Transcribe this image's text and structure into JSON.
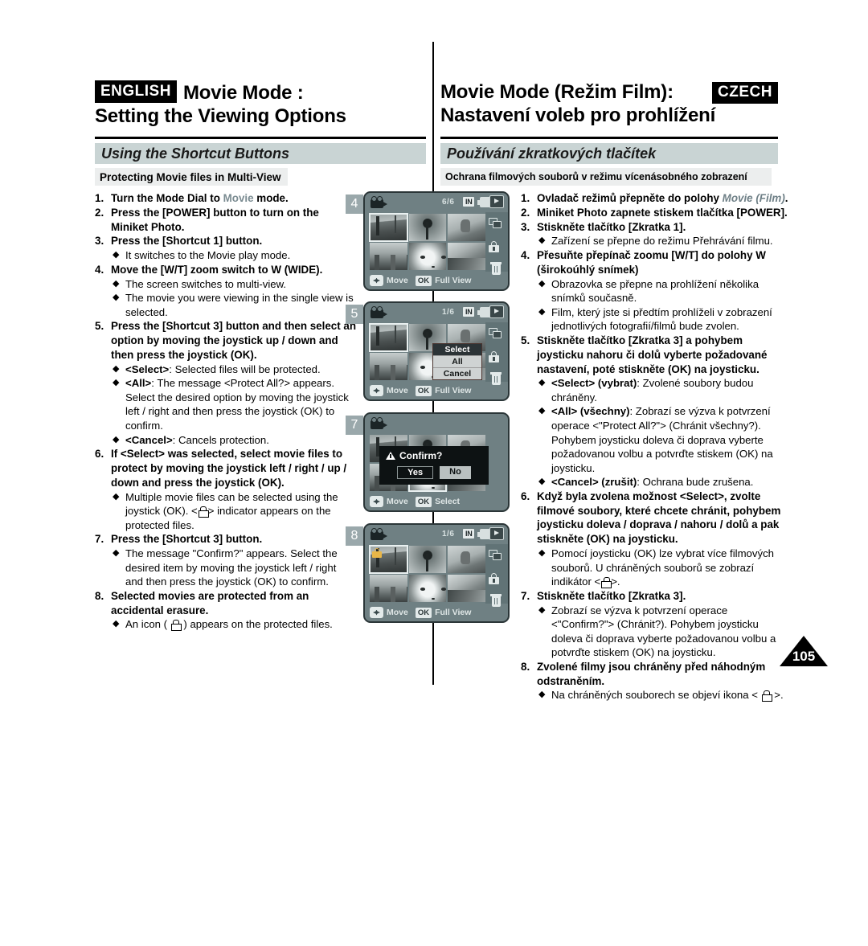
{
  "header": {
    "english_badge": "ENGLISH",
    "czech_badge": "CZECH",
    "en_title_line1": "Movie Mode :",
    "en_title_line2": "Setting the Viewing Options",
    "cz_title_line1": "Movie Mode (Režim Film):",
    "cz_title_line2": "Nastavení voleb pro prohlížení"
  },
  "sections": {
    "en_banner": "Using the Shortcut Buttons",
    "cz_banner": "Používání zkratkových tlačítek",
    "en_subbar": "Protecting Movie files in Multi-View",
    "cz_subbar": "Ochrana filmových souborů v režimu vícenásobného zobrazení"
  },
  "english_steps": {
    "s1_num": "1.",
    "s1_a": "Turn the Mode Dial to ",
    "s1_mode": "Movie",
    "s1_b": " mode.",
    "s2_num": "2.",
    "s2": "Press the [POWER] button to turn on the Miniket Photo.",
    "s3_num": "3.",
    "s3": "Press the [Shortcut 1] button.",
    "s3_b1": "It switches to the Movie play mode.",
    "s4_num": "4.",
    "s4": "Move the [W/T] zoom switch to W (WIDE).",
    "s4_b1": "The screen switches to multi-view.",
    "s4_b2": "The movie you were viewing in the single view is selected.",
    "s5_num": "5.",
    "s5": "Press the [Shortcut 3] button and then select an option by moving the joystick up / down and then press the joystick (OK).",
    "s5_b1_key": "<Select>",
    "s5_b1_txt": ": Selected files will be protected.",
    "s5_b2_key": "<All>",
    "s5_b2_txt": ": The message <Protect All?> appears. Select the desired option by moving the joystick left / right and then press the joystick (OK) to confirm.",
    "s5_b3_key": "<Cancel>",
    "s5_b3_txt": ": Cancels protection.",
    "s6_num": "6.",
    "s6": "If <Select> was selected, select movie files to protect by moving the joystick left / right / up / down and press the joystick (OK).",
    "s6_b1_pre": "Multiple movie files can be selected using the joystick (OK). <",
    "s6_b1_post": "> indicator appears on the protected files.",
    "s7_num": "7.",
    "s7": "Press the [Shortcut 3] button.",
    "s7_b1": "The message \"Confirm?\" appears. Select the desired item by moving the joystick left / right and then press the joystick (OK) to confirm.",
    "s8_num": "8.",
    "s8": "Selected movies are protected from an accidental erasure.",
    "s8_b1_pre": "An icon ( ",
    "s8_b1_post": " ) appears on the protected files."
  },
  "czech_steps": {
    "s1_num": "1.",
    "s1_a": "Ovladač režimů přepněte do polohy ",
    "s1_mode": "Movie (Film)",
    "s1_b": ".",
    "s2_num": "2.",
    "s2": "Miniket Photo zapnete stiskem tlačítka [POWER].",
    "s3_num": "3.",
    "s3": "Stiskněte tlačítko [Zkratka 1].",
    "s3_b1": "Zařízení se přepne do režimu Přehrávání filmu.",
    "s4_num": "4.",
    "s4": "Přesuňte přepínač zoomu [W/T] do polohy W (širokoúhlý snímek)",
    "s4_b1": "Obrazovka se přepne na prohlížení několika snímků současně.",
    "s4_b2": "Film, který jste si předtím prohlíželi v  zobrazení jednotlivých fotografií/filmů bude zvolen.",
    "s5_num": "5.",
    "s5": "Stiskněte tlačítko [Zkratka 3] a pohybem joysticku nahoru či dolů vyberte požadované nastavení, poté stiskněte (OK) na joysticku.",
    "s5_b1_key": "<Select> (vybrat)",
    "s5_b1_txt": ": Zvolené soubory budou chráněny.",
    "s5_b2_key": "<All> (všechny)",
    "s5_b2_txt": ": Zobrazí se výzva k potvrzení operace <\"Protect All?\"> (Chránit všechny?). Pohybem joysticku doleva či doprava vyberte požadovanou volbu a potvrďte stiskem (OK) na joysticku.",
    "s5_b3_key": "<Cancel> (zrušit)",
    "s5_b3_txt": ": Ochrana bude zrušena.",
    "s6_num": "6.",
    "s6": "Když byla zvolena možnost <Select>, zvolte filmové soubory, které chcete chránit, pohybem joysticku doleva / doprava / nahoru / dolů a pak stiskněte (OK) na joysticku.",
    "s6_b1_pre": "Pomocí joysticku (OK) lze vybrat více filmových souborů. U chráněných souborů se zobrazí indikátor <",
    "s6_b1_post": ">.",
    "s7_num": "7.",
    "s7": "Stiskněte tlačítko [Zkratka 3].",
    "s7_b1": "Zobrazí se výzva k potvrzení operace <\"Confirm?\"> (Chránit?). Pohybem joysticku doleva či doprava vyberte požadovanou volbu a potvrďte stiskem (OK) na joysticku.",
    "s8_num": "8.",
    "s8": "Zvolené filmy jsou chráněny před náhodným odstraněním.",
    "s8_b1_pre": "Na chráněných souborech se objeví ikona < ",
    "s8_b1_post": " >."
  },
  "bullet_mark": "◆",
  "panels": [
    {
      "badge": "4",
      "counter": "6/6",
      "storage": "IN",
      "hint_move": "Move",
      "ok_key": "OK",
      "hint_ok": "Full View",
      "menu": null,
      "dialog": null,
      "locked_thumb": false
    },
    {
      "badge": "5",
      "counter": "1/6",
      "storage": "IN",
      "hint_move": "Move",
      "ok_key": "OK",
      "hint_ok": "Full View",
      "menu": {
        "items": [
          "Select",
          "All",
          "Cancel"
        ],
        "selected": "Select"
      },
      "dialog": null,
      "locked_thumb": false
    },
    {
      "badge": "7",
      "counter": "",
      "storage": "",
      "hint_move": "Move",
      "ok_key": "OK",
      "hint_ok": "Select",
      "menu": null,
      "dialog": {
        "title": "Confirm?",
        "yes": "Yes",
        "no": "No",
        "selected": "Yes"
      },
      "locked_thumb": false
    },
    {
      "badge": "8",
      "counter": "1/6",
      "storage": "IN",
      "hint_move": "Move",
      "ok_key": "OK",
      "hint_ok": "Full View",
      "menu": null,
      "dialog": null,
      "locked_thumb": true
    }
  ],
  "page_number": "105",
  "colors": {
    "banner": "#c9d4d4",
    "subbar": "#eceeee",
    "lcd_bg": "#6f8083",
    "lcd_rail": "#617376",
    "badge_gray": "#9aa8ab",
    "accent_muted": "#6e7f86"
  }
}
